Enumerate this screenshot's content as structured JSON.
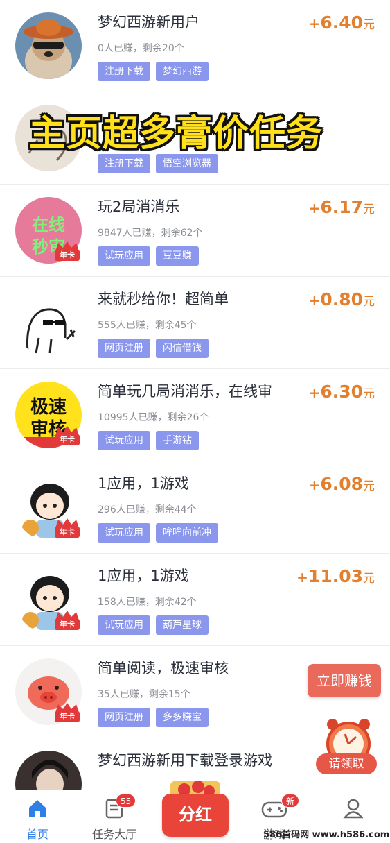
{
  "tasks": [
    {
      "title": "梦幻西游新用户",
      "plus": "+",
      "amount": "6.40",
      "unit": "元",
      "meta": "0人已赚，剩余20个",
      "tags": [
        "注册下载",
        "梦幻西游"
      ],
      "avatar": "dog-avatar",
      "crown": ""
    },
    {
      "title": "",
      "plus": "",
      "amount": "",
      "unit": "",
      "meta": "",
      "tags": [
        "注册下载",
        "悟空浏览器"
      ],
      "avatar": "sketch-avatar",
      "crown": ""
    },
    {
      "title": "玩2局消消乐",
      "plus": "+",
      "amount": "6.17",
      "unit": "元",
      "meta": "9847人已赚，剩余62个",
      "tags": [
        "试玩应用",
        "豆豆赚"
      ],
      "avatar": "online-review-avatar",
      "avatar_text": [
        "在线",
        "秒审"
      ],
      "crown": "年卡"
    },
    {
      "title": "来就秒给你！超简单",
      "plus": "+",
      "amount": "0.80",
      "unit": "元",
      "meta": "555人已赚，剩余45个",
      "tags": [
        "网页注册",
        "闪信借钱"
      ],
      "avatar": "sunglasses-doodle-avatar",
      "crown": ""
    },
    {
      "title": "简单玩几局消消乐，在线审",
      "plus": "+",
      "amount": "6.30",
      "unit": "元",
      "meta": "10995人已赚，剩余26个",
      "tags": [
        "试玩应用",
        "手游钻"
      ],
      "avatar": "fast-review-avatar",
      "avatar_text": [
        "极速",
        "审核"
      ],
      "crown": "年卡"
    },
    {
      "title": "1应用，1游戏",
      "plus": "+",
      "amount": "6.08",
      "unit": "元",
      "meta": "296人已赚，剩余44个",
      "tags": [
        "试玩应用",
        "哞哞向前冲"
      ],
      "avatar": "girl-avatar",
      "crown": "年卡"
    },
    {
      "title": "1应用，1游戏",
      "plus": "+",
      "amount": "11.03",
      "unit": "元",
      "meta": "158人已赚，剩余42个",
      "tags": [
        "试玩应用",
        "葫芦星球"
      ],
      "avatar": "girl-avatar",
      "crown": "年卡"
    },
    {
      "title": "简单阅读，极速审核",
      "plus": "",
      "amount": "",
      "unit": "",
      "meta": "35人已赚，剩余15个",
      "tags": [
        "网页注册",
        "多多赚宝"
      ],
      "avatar": "pig-avatar",
      "crown": "年卡"
    },
    {
      "title": "梦幻西游新用下载登录游戏",
      "plus": "",
      "amount": "",
      "unit": "",
      "meta": "",
      "tags": [],
      "avatar": "person-avatar",
      "crown": ""
    }
  ],
  "overlay_banner": "主页超多膏价任务",
  "float_earn_label": "立即赚钱",
  "float_claim_label": "请领取",
  "tabbar": {
    "home": {
      "label": "首页",
      "icon": "home-icon"
    },
    "tasks": {
      "label": "任务大厅",
      "icon": "task-list-icon",
      "badge": "55"
    },
    "dividend": {
      "label": "分红"
    },
    "games": {
      "label": "游戏",
      "icon": "gamepad-icon",
      "badge": "新"
    },
    "mine": {
      "label": "",
      "icon": "user-icon"
    }
  },
  "watermark": "586首码网 www.h586.com",
  "colors": {
    "accent": "#2f7fe6",
    "reward": "#e2802f",
    "tag": "#8a97ec",
    "badge": "#e23a3a",
    "banner": "#ffe01a"
  }
}
